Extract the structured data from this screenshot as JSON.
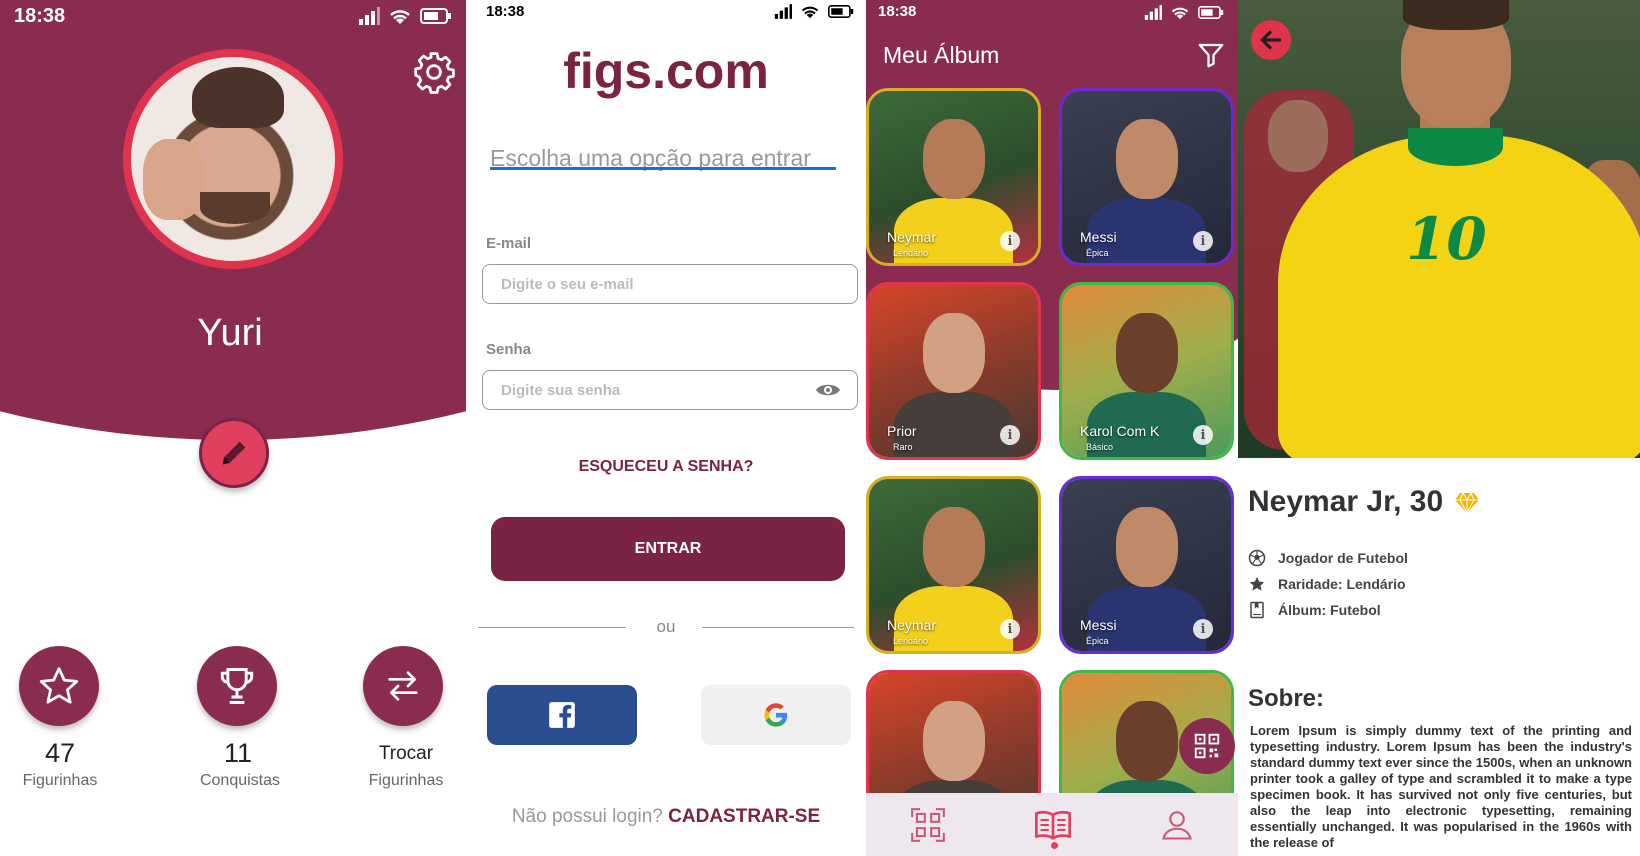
{
  "colors": {
    "primary": "#8a2c50",
    "accent": "#e0344e",
    "link": "#1f6fd0",
    "gem": "#f2b600"
  },
  "profile": {
    "time": "18:38",
    "name": "Yuri",
    "stats": [
      {
        "value": "47",
        "label": "Figurinhas",
        "icon": "star-icon"
      },
      {
        "value": "11",
        "label": "Conquistas",
        "icon": "trophy-icon"
      },
      {
        "value": "Trocar",
        "label": "Figurinhas",
        "icon": "swap-icon"
      }
    ]
  },
  "login": {
    "time": "18:38",
    "brand": "figs.com",
    "subtitle": "Escolha uma opção para entrar",
    "email_label": "E-mail",
    "email_placeholder": "Digite o seu e-mail",
    "password_label": "Senha",
    "password_placeholder": "Digite sua senha",
    "forgot": "ESQUECEU A SENHA?",
    "enter": "ENTRAR",
    "or": "ou",
    "no_login": "Não possui login?",
    "signup": "CADASTRAR-SE"
  },
  "album": {
    "time": "18:38",
    "title": "Meu Álbum",
    "cards": [
      {
        "name": "Neymar",
        "rarity": "Lendário"
      },
      {
        "name": "Messi",
        "rarity": "Épica"
      },
      {
        "name": "Prior",
        "rarity": "Raro"
      },
      {
        "name": "Karol Com K",
        "rarity": "Básico"
      },
      {
        "name": "Neymar",
        "rarity": "Lendário"
      },
      {
        "name": "Messi",
        "rarity": "Épica"
      }
    ]
  },
  "detail": {
    "title": "Neymar Jr, 30",
    "attributes": [
      {
        "icon": "soccer-ball-icon",
        "text": "Jogador de Futebol"
      },
      {
        "icon": "star-icon",
        "text": "Raridade: Lendário"
      },
      {
        "icon": "album-icon",
        "text": "Álbum: Futebol"
      }
    ],
    "about_title": "Sobre:",
    "about_text": "Lorem Ipsum is simply dummy text of the printing and typesetting industry. Lorem Ipsum has been the industry's standard dummy text ever since the 1500s, when an unknown printer took a galley of type and scrambled it to make a type specimen book. It has survived not only five centuries, but also the leap into electronic typesetting, remaining essentially unchanged. It was popularised in the 1960s with the release of"
  }
}
